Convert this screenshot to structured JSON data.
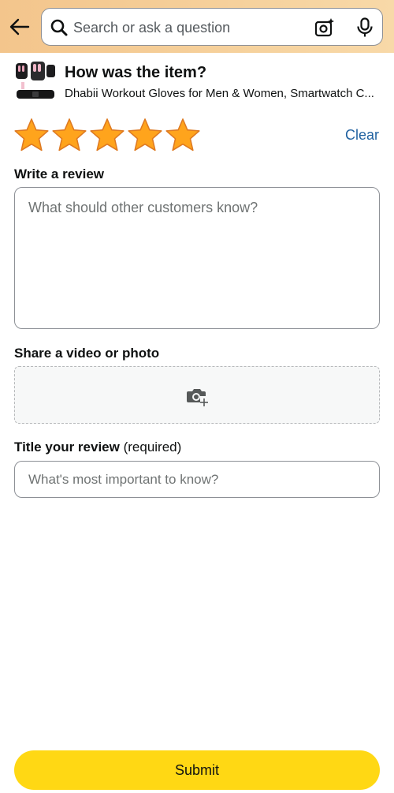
{
  "search": {
    "placeholder": "Search or ask a question"
  },
  "item": {
    "question": "How was the item?",
    "name": "Dhabii Workout Gloves for Men & Women, Smartwatch C..."
  },
  "rating": {
    "stars": 5,
    "max_stars": 5,
    "star_color": "#ffa41c",
    "clear_label": "Clear"
  },
  "review": {
    "label": "Write a review",
    "placeholder": "What should other customers know?"
  },
  "media": {
    "label": "Share a video or photo"
  },
  "title": {
    "label": "Title your review",
    "required_text": "(required)",
    "placeholder": "What's most important to know?"
  },
  "submit": {
    "label": "Submit",
    "color": "#ffd814"
  }
}
